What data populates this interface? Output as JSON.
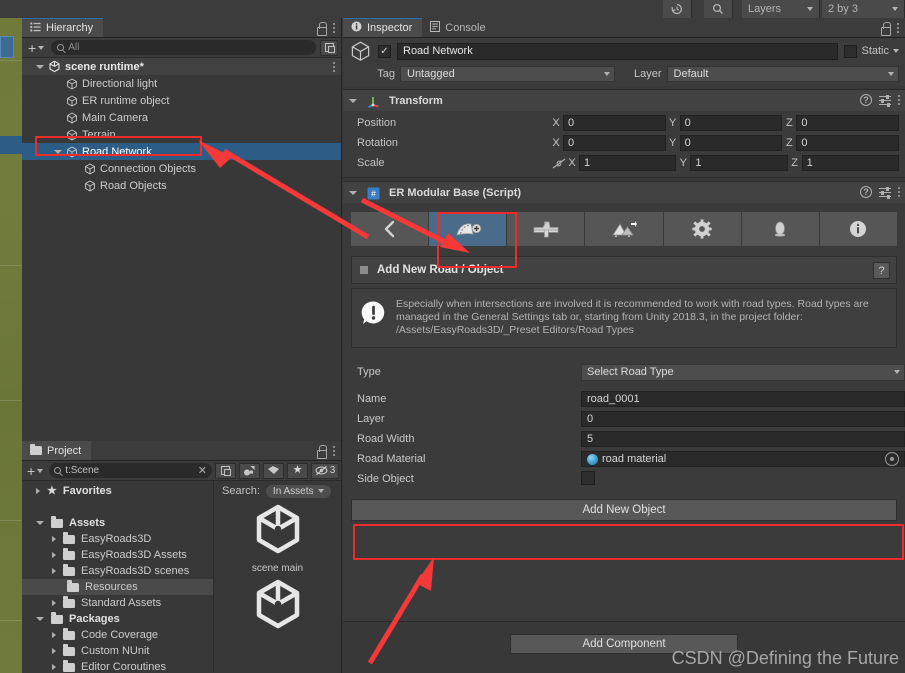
{
  "top_toolbar": {
    "history_icon": "history-icon",
    "search_icon": "search-icon",
    "layers_label": "Layers",
    "layout_label": "2 by 3"
  },
  "hierarchy": {
    "tab_label": "Hierarchy",
    "tab_icon": "hierarchy-icon",
    "create_label": "+",
    "search_placeholder": "All",
    "search_value": "",
    "items": [
      {
        "label": "scene runtime*",
        "indent": 0,
        "icon": "unity-scene-icon",
        "arrow": "open",
        "kind": "scene"
      },
      {
        "label": "Directional light",
        "indent": 1,
        "icon": "gameobject-cube-icon",
        "arrow": "none",
        "kind": "go"
      },
      {
        "label": "ER runtime object",
        "indent": 1,
        "icon": "gameobject-cube-icon",
        "arrow": "none",
        "kind": "go"
      },
      {
        "label": "Main Camera",
        "indent": 1,
        "icon": "gameobject-cube-icon",
        "arrow": "none",
        "kind": "go"
      },
      {
        "label": "Terrain",
        "indent": 1,
        "icon": "gameobject-cube-icon",
        "arrow": "none",
        "kind": "go"
      },
      {
        "label": "Road Network",
        "indent": 1,
        "icon": "gameobject-cube-icon",
        "arrow": "open",
        "kind": "selected"
      },
      {
        "label": "Connection Objects",
        "indent": 2,
        "icon": "gameobject-cube-icon",
        "arrow": "none",
        "kind": "go"
      },
      {
        "label": "Road Objects",
        "indent": 2,
        "icon": "gameobject-cube-icon",
        "arrow": "none",
        "kind": "go"
      }
    ]
  },
  "project": {
    "tab_label": "Project",
    "tab_icon": "folder-icon",
    "create_label": "+",
    "search_value": "t:Scene",
    "hidden_count": "3",
    "search_label": "Search:",
    "search_scope": "In Assets",
    "tree": [
      {
        "label": "Favorites",
        "indent": 0,
        "arrow": "closed",
        "icon": "star-icon",
        "bold": true,
        "selected": false
      },
      {
        "label": "",
        "indent": 0,
        "arrow": "none",
        "icon": "spacer",
        "bold": false,
        "selected": false
      },
      {
        "label": "Assets",
        "indent": 0,
        "arrow": "open",
        "icon": "folder-open-icon",
        "bold": true,
        "selected": false
      },
      {
        "label": "EasyRoads3D",
        "indent": 1,
        "arrow": "closed",
        "icon": "folder-icon",
        "bold": false,
        "selected": false
      },
      {
        "label": "EasyRoads3D Assets",
        "indent": 1,
        "arrow": "closed",
        "icon": "folder-icon",
        "bold": false,
        "selected": false
      },
      {
        "label": "EasyRoads3D scenes",
        "indent": 1,
        "arrow": "closed",
        "icon": "folder-icon",
        "bold": false,
        "selected": false
      },
      {
        "label": "Resources",
        "indent": 1,
        "arrow": "none",
        "icon": "folder-icon",
        "bold": false,
        "selected": true
      },
      {
        "label": "Standard Assets",
        "indent": 1,
        "arrow": "closed",
        "icon": "folder-icon",
        "bold": false,
        "selected": false
      },
      {
        "label": "Packages",
        "indent": 0,
        "arrow": "open",
        "icon": "folder-open-icon",
        "bold": true,
        "selected": false
      },
      {
        "label": "Code Coverage",
        "indent": 1,
        "arrow": "closed",
        "icon": "folder-icon",
        "bold": false,
        "selected": false
      },
      {
        "label": "Custom NUnit",
        "indent": 1,
        "arrow": "closed",
        "icon": "folder-icon",
        "bold": false,
        "selected": false
      },
      {
        "label": "Editor Coroutines",
        "indent": 1,
        "arrow": "closed",
        "icon": "folder-icon",
        "bold": false,
        "selected": false
      }
    ],
    "assets": [
      {
        "label": "scene main",
        "icon": "unity-scene-asset-icon"
      },
      {
        "label": "",
        "icon": "unity-scene-asset-icon"
      }
    ]
  },
  "inspector": {
    "tabs": [
      {
        "label": "Inspector",
        "icon": "info-icon",
        "active": true
      },
      {
        "label": "Console",
        "icon": "console-icon",
        "active": false
      }
    ],
    "object": {
      "enabled_checkmark": "✓",
      "name": "Road Network",
      "static_label": "Static",
      "tag_label": "Tag",
      "tag_value": "Untagged",
      "layer_label": "Layer",
      "layer_value": "Default"
    },
    "transform": {
      "title": "Transform",
      "icon": "transform-axis-icon",
      "rows": [
        {
          "label": "Position",
          "x": "0",
          "y": "0",
          "z": "0",
          "link": false
        },
        {
          "label": "Rotation",
          "x": "0",
          "y": "0",
          "z": "0",
          "link": false
        },
        {
          "label": "Scale",
          "x": "1",
          "y": "1",
          "z": "1",
          "link": true
        }
      ],
      "axis_labels": [
        "X",
        "Y",
        "Z"
      ]
    },
    "er_modular_base": {
      "title": "ER Modular Base (Script)",
      "icon": "script-icon",
      "toolbar": [
        {
          "name": "back-arrow-button",
          "icon": "chevron-left-icon",
          "selected": false
        },
        {
          "name": "add-road-button",
          "icon": "road-plus-icon",
          "selected": true
        },
        {
          "name": "flying-object-button",
          "icon": "crossing-icon",
          "selected": false
        },
        {
          "name": "terrain-button",
          "icon": "terrain-icon",
          "selected": false
        },
        {
          "name": "general-settings-button",
          "icon": "gear-icon",
          "selected": false
        },
        {
          "name": "scene-objects-button",
          "icon": "object-icon",
          "selected": false
        },
        {
          "name": "info-button",
          "icon": "info-circle-icon",
          "selected": false
        }
      ],
      "section_title": "Add New Road / Object",
      "help_button": "?",
      "help_text": "Especially when intersections are involved it is recommended to work with road types. Road types are managed in the General Settings tab or, starting from Unity 2018.3, in the project folder: /Assets/EasyRoads3D/_Preset Editors/Road Types",
      "fields": [
        {
          "label": "Type",
          "value": "Select Road Type",
          "type": "dropdown"
        },
        {
          "label": "Name",
          "value": "road_0001",
          "type": "text"
        },
        {
          "label": "Layer",
          "value": "0",
          "type": "text"
        },
        {
          "label": "Road Width",
          "value": "5",
          "type": "text"
        },
        {
          "label": "Road Material",
          "value": "road material",
          "type": "object"
        },
        {
          "label": "Side Object",
          "value": "",
          "type": "checkbox"
        }
      ],
      "add_new_object_button": "Add New Object"
    },
    "add_component_button": "Add Component"
  },
  "watermark": "CSDN @Defining the Future",
  "colors": {
    "accent_selection": "#2c5d87",
    "annotation_red": "#ef2b2b",
    "panel_bg": "#383838",
    "toolbar_bg": "#3c3c3c",
    "field_bg": "#2a2a2a"
  }
}
